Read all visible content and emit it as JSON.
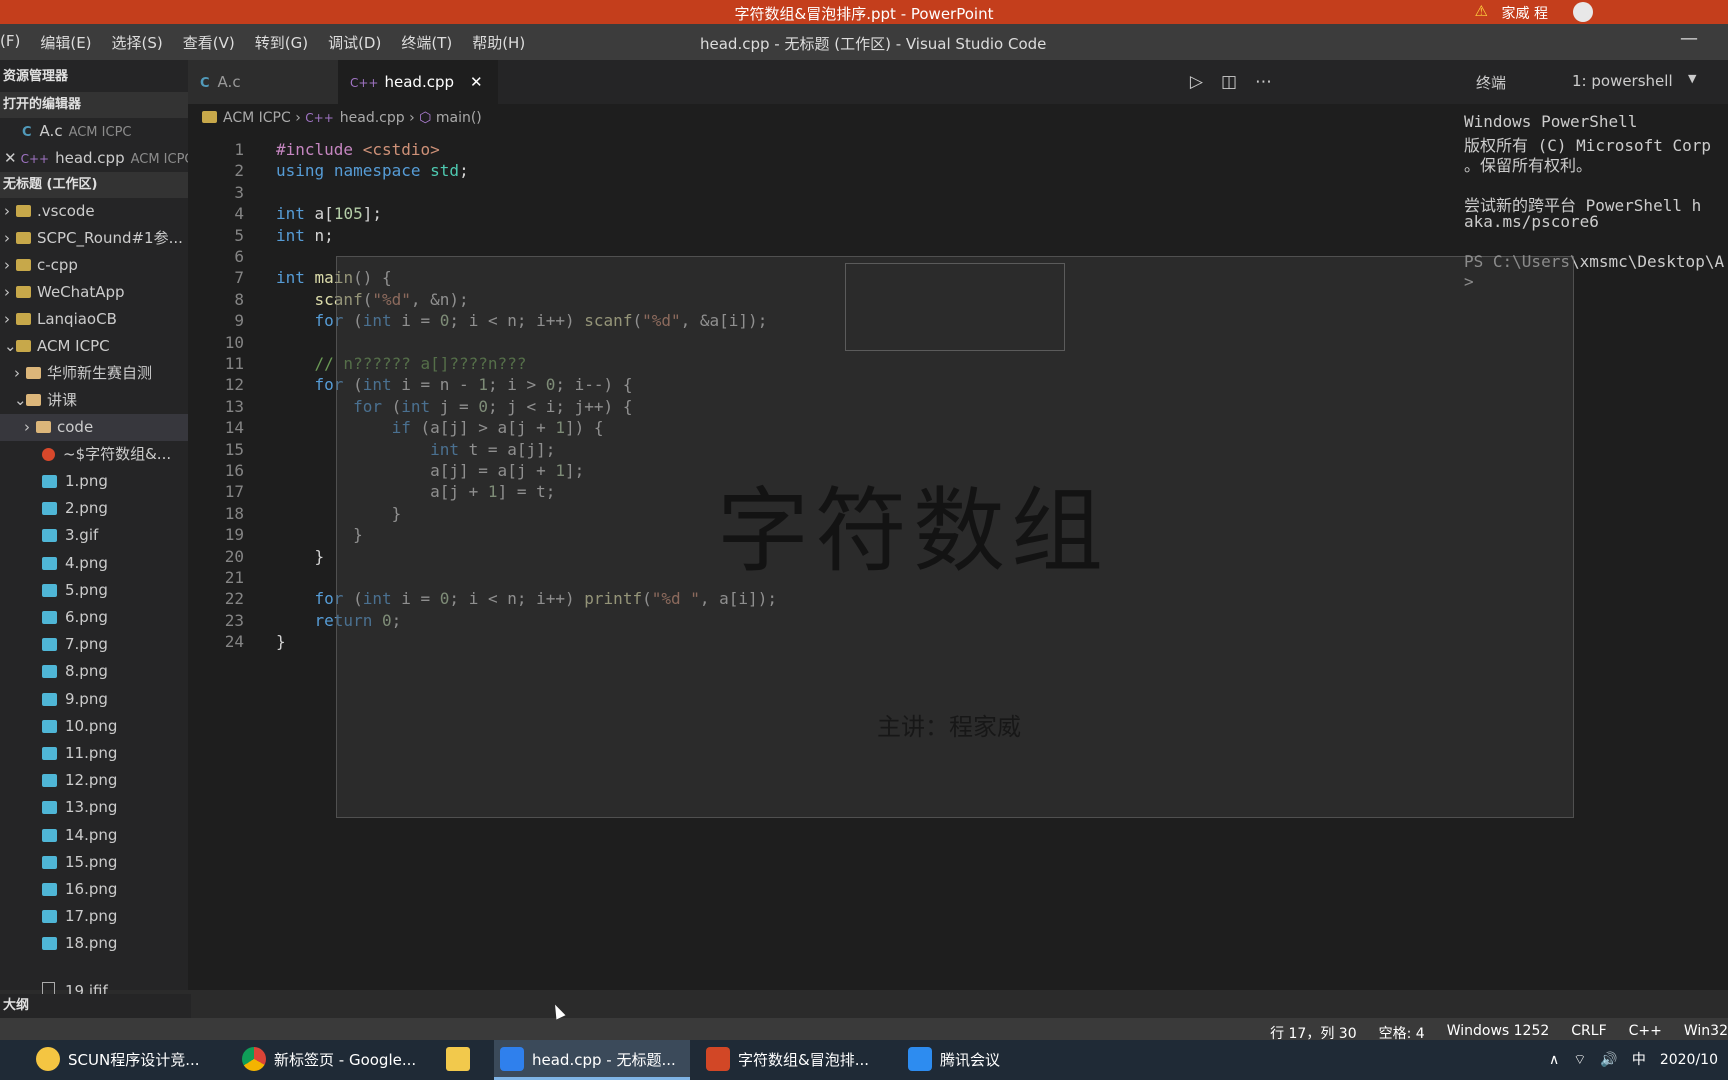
{
  "powerpoint": {
    "title": "字符数组&冒泡排序.ppt - PowerPoint",
    "user": "家威 程"
  },
  "vscode": {
    "title": "head.cpp - 无标题 (工作区) - Visual Studio Code",
    "menu": [
      "(F)",
      "编辑(E)",
      "选择(S)",
      "查看(V)",
      "转到(G)",
      "调试(D)",
      "终端(T)",
      "帮助(H)"
    ]
  },
  "explorer": {
    "header": "资源管理器",
    "open_editors_header": "打开的编辑器",
    "open_editors": [
      {
        "name": "A.c",
        "path": "ACM ICPC"
      },
      {
        "name": "head.cpp",
        "path": "ACM ICPC"
      }
    ],
    "workspace_header": "无标题 (工作区)",
    "folders": [
      ".vscode",
      "SCPC_Round#1参...",
      "c-cpp",
      "WeChatApp",
      "LanqiaoCB",
      "ACM ICPC"
    ],
    "acm_children": [
      "华师新生赛自测",
      "讲课"
    ],
    "lecture_children": [
      "code",
      "~$字符数组&..."
    ],
    "images": [
      "1.png",
      "2.png",
      "3.gif",
      "4.png",
      "5.png",
      "6.png",
      "7.png",
      "8.png",
      "9.png",
      "10.png",
      "11.png",
      "12.png",
      "13.png",
      "14.png",
      "15.png",
      "16.png",
      "17.png",
      "18.png",
      "19.jfif"
    ],
    "outline_header": "大纲"
  },
  "tabs": [
    {
      "label": "A.c"
    },
    {
      "label": "head.cpp"
    }
  ],
  "breadcrumb": {
    "folder": "ACM ICPC",
    "file": "head.cpp",
    "symbol": "main()"
  },
  "code_lines": [
    "#include <cstdio>",
    "using namespace std;",
    "",
    "int a[105];",
    "int n;",
    "",
    "int main() {",
    "    scanf(\"%d\", &n);",
    "    for (int i = 0; i < n; i++) scanf(\"%d\", &a[i]);",
    "",
    "    // n?????? a[]????n???",
    "    for (int i = n - 1; i > 0; i--) {",
    "        for (int j = 0; j < i; j++) {",
    "            if (a[j] > a[j + 1]) {",
    "                int t = a[j];",
    "                a[j] = a[j + 1];",
    "                a[j + 1] = t;",
    "            }",
    "        }",
    "    }",
    "",
    "    for (int i = 0; i < n; i++) printf(\"%d \", a[i]);",
    "    return 0;",
    "}"
  ],
  "terminal": {
    "tab_label": "终端",
    "shell": "1: powershell",
    "lines": [
      "Windows PowerShell",
      "版权所有 (C) Microsoft Corp",
      "。保留所有权利。",
      "",
      "尝试新的跨平台 PowerShell h",
      "aka.ms/pscore6",
      "",
      "PS C:\\Users\\xmsmc\\Desktop\\A",
      ">"
    ]
  },
  "slide": {
    "title": "字符数组",
    "subtitle": "主讲：程家威"
  },
  "status": {
    "position": "行 17，列 30",
    "spaces": "空格: 4",
    "encoding": "Windows 1252",
    "eol": "CRLF",
    "language": "C++",
    "platform": "Win32"
  },
  "taskbar": {
    "items": [
      "SCUN程序设计竞...",
      "新标签页 - Google...",
      "",
      "head.cpp - 无标题...",
      "字符数组&冒泡排...",
      "腾讯会议"
    ],
    "ime": "中",
    "date": "2020/10"
  }
}
